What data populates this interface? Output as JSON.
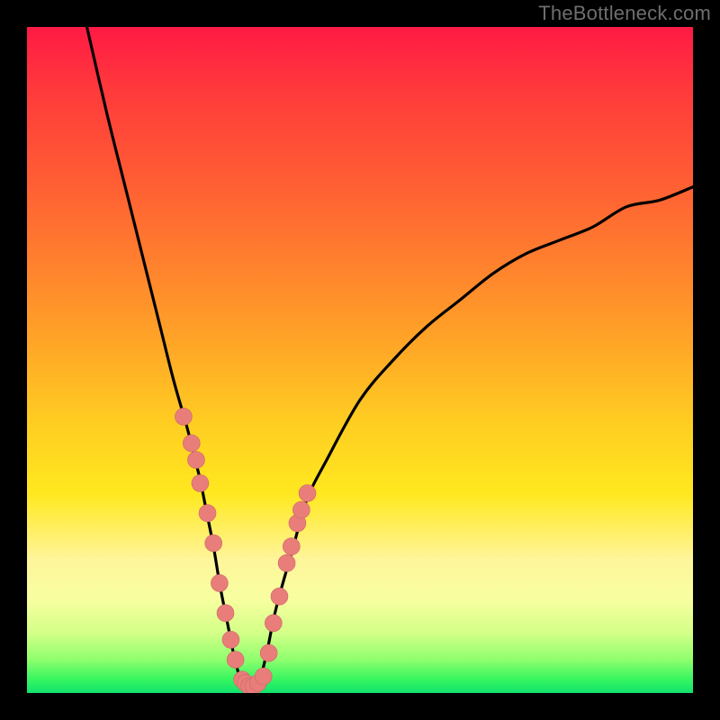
{
  "watermark": "TheBottleneck.com",
  "colors": {
    "background": "#000000",
    "curve": "#000000",
    "marker_fill": "#e97d7a",
    "marker_stroke": "#c96a67",
    "gradient": [
      "#ff1a44",
      "#ff3b3b",
      "#ff5a34",
      "#ff7f2e",
      "#ffa726",
      "#ffcf22",
      "#ffe81f",
      "#fff59b",
      "#f7ffa0",
      "#d3ff87",
      "#8fff6e",
      "#35f55f",
      "#11e36e"
    ]
  },
  "chart_data": {
    "type": "line",
    "title": "",
    "xlabel": "",
    "ylabel": "",
    "xlim": [
      0,
      100
    ],
    "ylim": [
      0,
      100
    ],
    "series": [
      {
        "name": "left-branch",
        "x": [
          9,
          12,
          15,
          18,
          20,
          22,
          24,
          25,
          26,
          27,
          28,
          29,
          30,
          31,
          32
        ],
        "y": [
          100,
          87,
          75,
          63,
          55,
          47,
          40,
          36,
          32,
          27,
          22,
          16,
          11,
          6,
          2
        ]
      },
      {
        "name": "right-branch",
        "x": [
          35,
          36,
          37,
          38,
          40,
          42,
          45,
          50,
          55,
          60,
          65,
          70,
          75,
          80,
          85,
          90,
          95,
          100
        ],
        "y": [
          2,
          6,
          11,
          15,
          22,
          29,
          35,
          44,
          50,
          55,
          59,
          63,
          66,
          68,
          70,
          73,
          74,
          76
        ]
      },
      {
        "name": "valley-floor",
        "x": [
          32,
          33,
          34,
          35
        ],
        "y": [
          2,
          1,
          1,
          2
        ]
      }
    ],
    "markers": {
      "name": "highlight-points",
      "x": [
        23.5,
        24.7,
        25.4,
        26.0,
        27.1,
        28.0,
        28.9,
        29.8,
        30.6,
        31.3,
        32.3,
        32.8,
        33.4,
        34.0,
        34.7,
        35.5,
        36.3,
        37.0,
        37.9,
        39.0,
        39.7,
        40.6,
        41.2,
        42.1
      ],
      "y": [
        41.5,
        37.5,
        35.0,
        31.5,
        27.0,
        22.5,
        16.5,
        12.0,
        8.0,
        5.0,
        2.0,
        1.5,
        1.0,
        1.0,
        1.5,
        2.5,
        6.0,
        10.5,
        14.5,
        19.5,
        22.0,
        25.5,
        27.5,
        30.0
      ]
    }
  }
}
